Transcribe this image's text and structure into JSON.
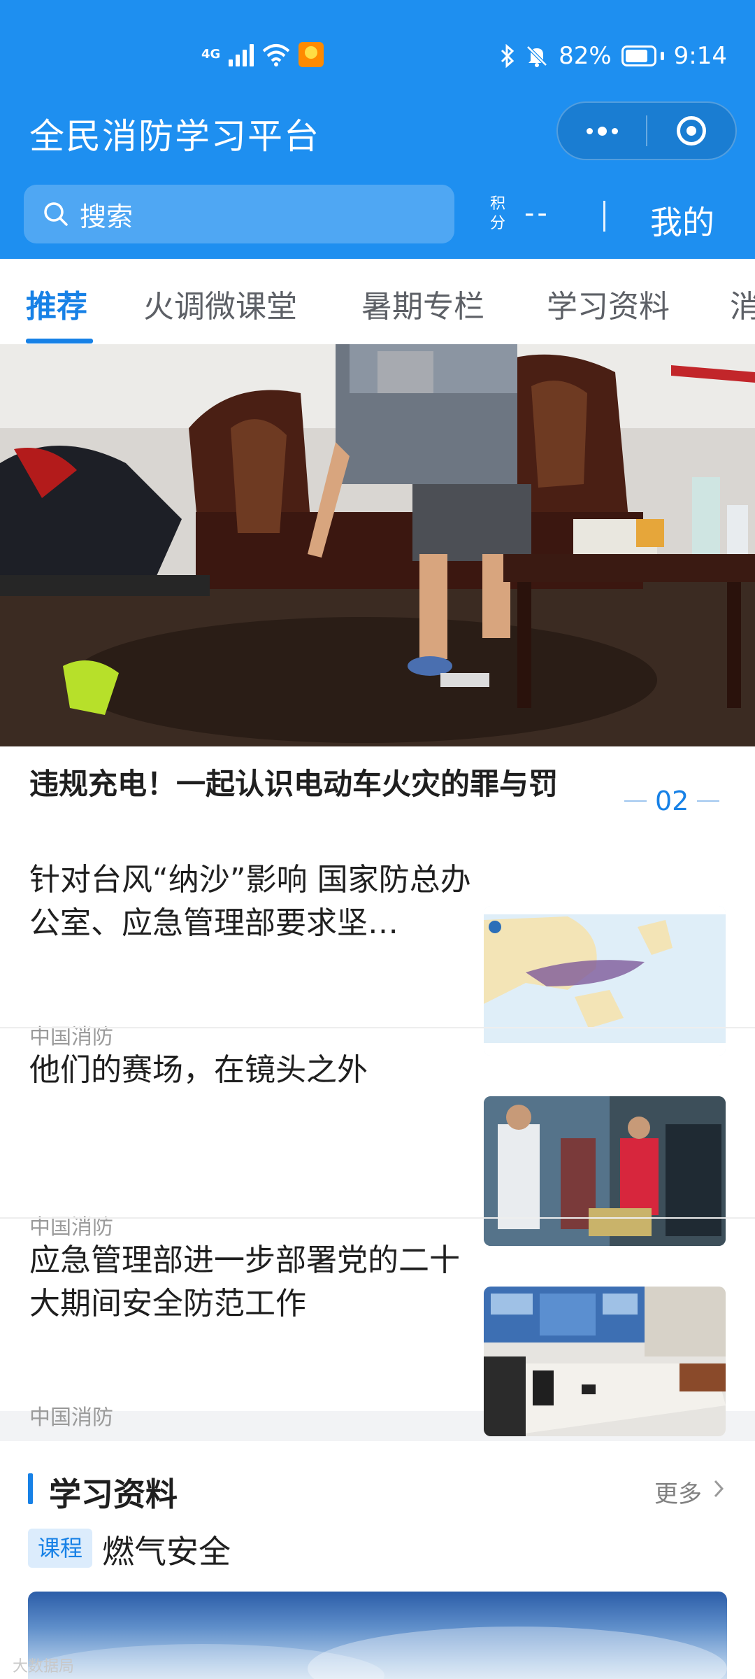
{
  "status_bar": {
    "network": "4G",
    "battery_percent": "82%",
    "battery_level": 0.82,
    "time": "9:14"
  },
  "header": {
    "title": "全民消防学习平台",
    "search_placeholder": "搜索",
    "points_label": "积分",
    "points_value": "--",
    "mine_label": "我的",
    "accent_color": "#1e8ff0"
  },
  "tabs": [
    {
      "label": "推荐",
      "active": true
    },
    {
      "label": "火调微课堂",
      "active": false
    },
    {
      "label": "暑期专栏",
      "active": false
    },
    {
      "label": "学习资料",
      "active": false
    },
    {
      "label": "消",
      "active": false
    }
  ],
  "featured": {
    "headline": "违规充电！一起认识电动车火灾的罪与罚",
    "page_indicator": "02"
  },
  "news": [
    {
      "title": "针对台风“纳沙”影响 国家防总办公室、应急管理部要求坚…",
      "source": "中国消防"
    },
    {
      "title": "他们的赛场，在镜头之外",
      "source": "中国消防"
    },
    {
      "title": "应急管理部进一步部署党的二十大期间安全防范工作",
      "source": "中国消防"
    }
  ],
  "study_section": {
    "title": "学习资料",
    "more_label": "更多",
    "course_tag": "课程",
    "course_name": "燃气安全"
  },
  "watermark": "大数据局"
}
